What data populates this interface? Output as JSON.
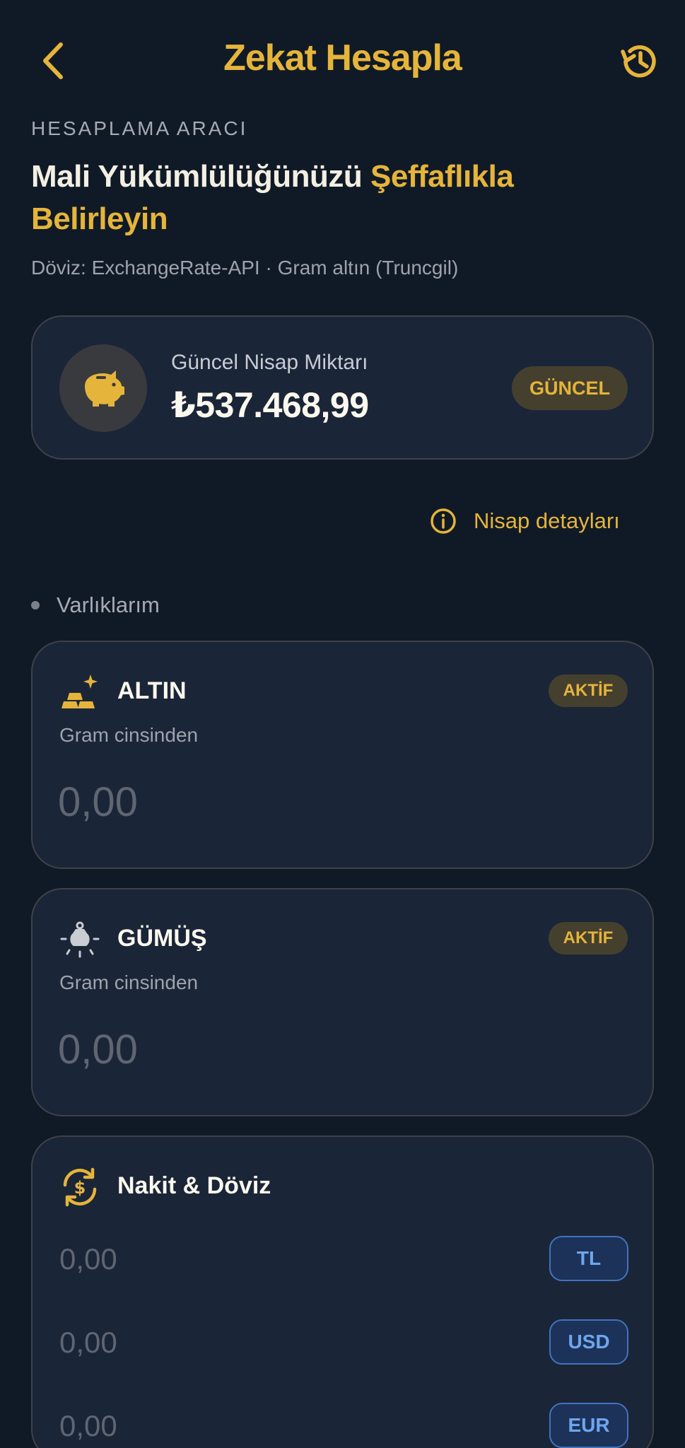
{
  "header": {
    "title": "Zekat Hesapla",
    "back_icon": "chevron-left-icon",
    "history_icon": "history-icon"
  },
  "intro": {
    "eyebrow": "HESAPLAMA ARACI",
    "headline_white": "Mali Yükümlülüğünüzü ",
    "headline_gold": "Şeffaflıkla Belirleyin",
    "source": "Döviz: ExchangeRate-API · Gram altın (Truncgil)"
  },
  "nisap": {
    "label": "Güncel Nisap Miktarı",
    "value": "₺537.468,99",
    "badge": "GÜNCEL",
    "icon": "piggy-bank-icon",
    "details_link": "Nisap detayları"
  },
  "section": {
    "label": "Varlıklarım"
  },
  "assets": {
    "altin": {
      "title": "ALTIN",
      "badge": "AKTİF",
      "subtitle": "Gram cinsinden",
      "placeholder": "0,00",
      "icon": "gold-bars-icon"
    },
    "gumus": {
      "title": "GÜMÜŞ",
      "badge": "AKTİF",
      "subtitle": "Gram cinsinden",
      "placeholder": "0,00",
      "icon": "silver-weight-icon"
    },
    "nakit": {
      "title": "Nakit & Döviz",
      "icon": "currency-exchange-icon",
      "rows": [
        {
          "placeholder": "0,00",
          "currency": "TL"
        },
        {
          "placeholder": "0,00",
          "currency": "USD"
        },
        {
          "placeholder": "0,00",
          "currency": "EUR"
        }
      ]
    }
  },
  "colors": {
    "background": "#101a27",
    "card": "#1b2538",
    "accent_gold": "#e5b43a",
    "badge_blue": "#6ea6ee"
  }
}
